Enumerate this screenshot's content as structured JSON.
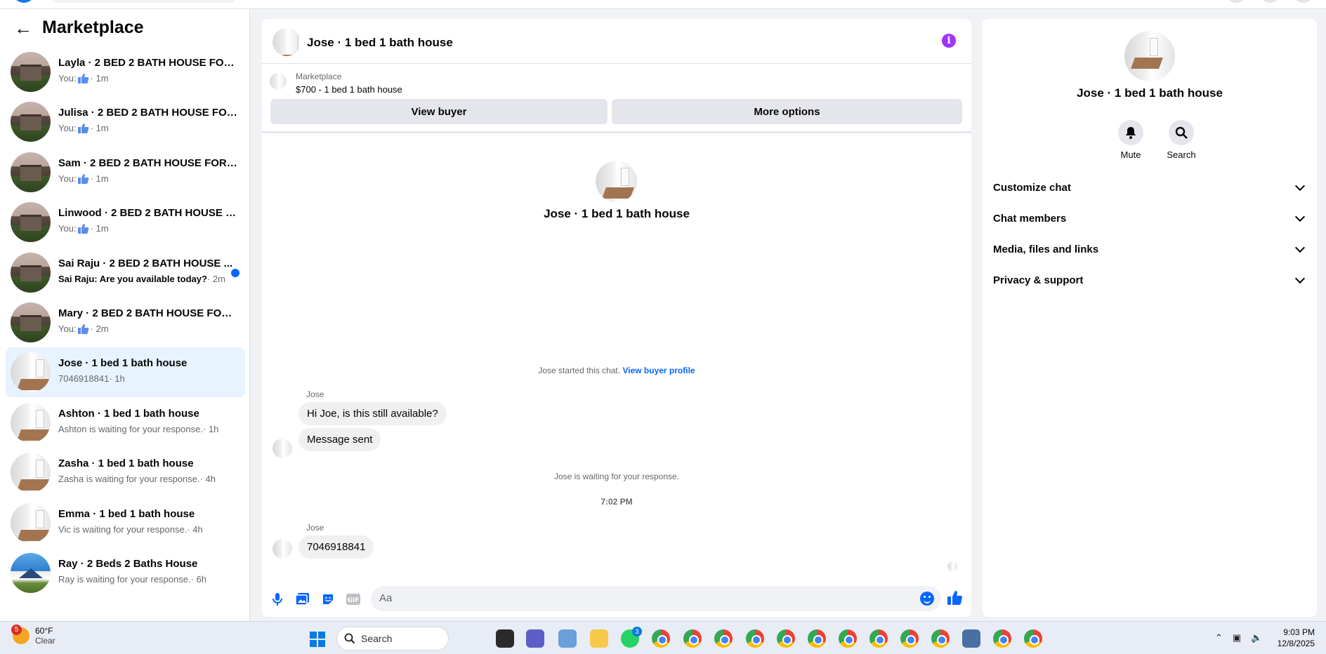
{
  "sidebar": {
    "title": "Marketplace",
    "conversations": [
      {
        "title": "Layla · 2 BED 2 BATH HOUSE FOR ...",
        "prefix": "You:",
        "time": "· 1m",
        "thumb": true,
        "avatar": "house"
      },
      {
        "title": "Julisa · 2 BED 2 BATH HOUSE FOR ...",
        "prefix": "You:",
        "time": "· 1m",
        "thumb": true,
        "avatar": "house"
      },
      {
        "title": "Sam · 2 BED 2 BATH HOUSE FOR R...",
        "prefix": "You:",
        "time": "· 1m",
        "thumb": true,
        "avatar": "house"
      },
      {
        "title": "Linwood · 2 BED 2 BATH HOUSE F...",
        "prefix": "You:",
        "time": "· 1m",
        "thumb": true,
        "avatar": "house"
      },
      {
        "title": "Sai Raju · 2 BED 2 BATH HOUSE ...",
        "prefix": "Sai Raju: Are you available today?",
        "time": "· 2m",
        "thumb": false,
        "unread": true,
        "avatar": "house"
      },
      {
        "title": "Mary · 2 BED 2 BATH HOUSE FOR ...",
        "prefix": "You:",
        "time": "· 2m",
        "thumb": true,
        "avatar": "house"
      },
      {
        "title": "Jose · 1 bed 1 bath house",
        "prefix": "7046918841",
        "time": "· 1h",
        "thumb": false,
        "active": true,
        "avatar": "room"
      },
      {
        "title": "Ashton · 1 bed 1 bath house",
        "prefix": "Ashton is waiting for your response.",
        "time": "· 1h",
        "thumb": false,
        "avatar": "room"
      },
      {
        "title": "Zasha · 1 bed 1 bath house",
        "prefix": "Zasha is waiting for your response.",
        "time": "· 4h",
        "thumb": false,
        "avatar": "room"
      },
      {
        "title": "Emma · 1 bed 1 bath house",
        "prefix": "Vic is waiting for your response.",
        "time": "· 4h",
        "thumb": false,
        "avatar": "room"
      },
      {
        "title": "Ray · 2 Beds 2 Baths House",
        "prefix": "Ray is waiting for your response.",
        "time": "· 6h",
        "thumb": false,
        "avatar": "blue"
      }
    ]
  },
  "chat": {
    "title": "Jose · 1 bed 1 bath house",
    "listing_source": "Marketplace",
    "listing_price": "$700 - 1 bed 1 bath house",
    "view_buyer": "View buyer",
    "more_options": "More options",
    "center_name": "Jose · 1 bed 1 bath house",
    "started_text": "Jose started this chat.",
    "view_buyer_profile": "View buyer profile",
    "sender1": "Jose",
    "msg1": "Hi Joe, is this still available?",
    "msg2": "Message sent",
    "waiting": "Jose is waiting for your response.",
    "time_sep": "7:02 PM",
    "sender2": "Jose",
    "msg3": "7046918841",
    "input_placeholder": "Aa"
  },
  "details": {
    "name": "Jose · 1 bed 1 bath house",
    "mute": "Mute",
    "search": "Search",
    "sections": [
      "Customize chat",
      "Chat members",
      "Media, files and links",
      "Privacy & support"
    ]
  },
  "taskbar": {
    "weather_temp": "60°F",
    "weather_cond": "Clear",
    "weather_badge": "5",
    "search": "Search",
    "whatsapp_badge": "3",
    "time": "9:03 PM",
    "date": "12/8/2025"
  },
  "colors": {
    "accent": "#0866ff",
    "info": "#a033ff",
    "active_row": "#e7f3ff"
  }
}
